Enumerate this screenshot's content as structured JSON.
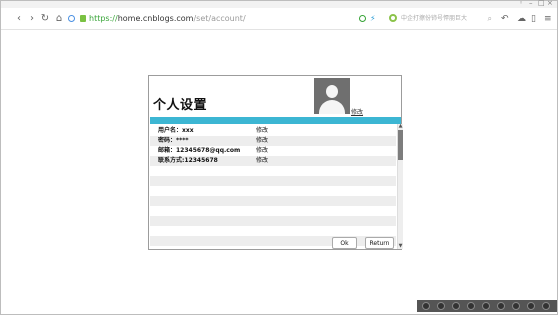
{
  "browser": {
    "url_scheme": "https://",
    "url_domain": "home.cnblogs.com",
    "url_path": "/set/account/",
    "search_placeholder": "中企打擦份铈号悍朋巨大",
    "nav_icons": [
      "back-icon",
      "forward-icon",
      "refresh-icon",
      "home-icon"
    ],
    "window_controls": [
      "◦",
      "–",
      "□",
      "×"
    ]
  },
  "panel": {
    "title": "个人设置",
    "edit_photo_label": "修改",
    "rows": [
      {
        "label": "用户名：xxx",
        "edit": "修改"
      },
      {
        "label": "密码：****",
        "edit": "修改"
      },
      {
        "label": "邮箱：12345678@qq.com",
        "edit": "修改"
      },
      {
        "label": "联系方式:12345678",
        "edit": "修改"
      }
    ],
    "ok_label": "Ok",
    "return_label": "Return"
  },
  "colors": {
    "accent_bar": "#3cb6d3",
    "row_stripe": "#ededed"
  }
}
